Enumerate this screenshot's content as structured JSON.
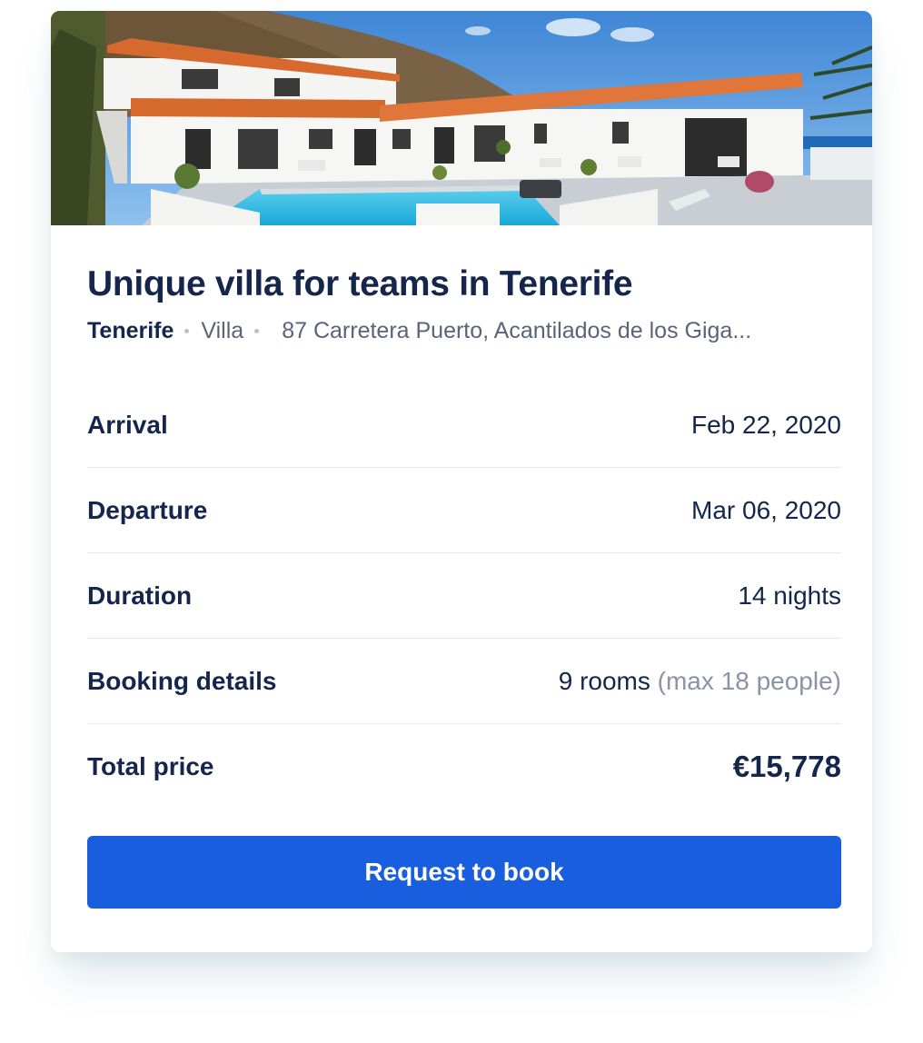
{
  "listing": {
    "image_alt": "White villa with orange tiled roof and swimming pool",
    "title": "Unique villa for teams in Tenerife",
    "city": "Tenerife",
    "type": "Villa",
    "address": "87 Carretera Puerto, Acantilados de los Giga..."
  },
  "details": {
    "arrival": {
      "label": "Arrival",
      "value": "Feb 22, 2020"
    },
    "departure": {
      "label": "Departure",
      "value": "Mar 06, 2020"
    },
    "duration": {
      "label": "Duration",
      "value": "14 nights"
    },
    "booking": {
      "label": "Booking details",
      "rooms": "9 rooms",
      "capacity": "(max 18 people)"
    },
    "total": {
      "label": "Total price",
      "value": "€15,778"
    }
  },
  "actions": {
    "request_label": "Request to book"
  },
  "colors": {
    "primary": "#1a5ee0",
    "text_dark": "#14264b",
    "text_muted": "#8a94a6",
    "divider": "#e4e7ec"
  }
}
